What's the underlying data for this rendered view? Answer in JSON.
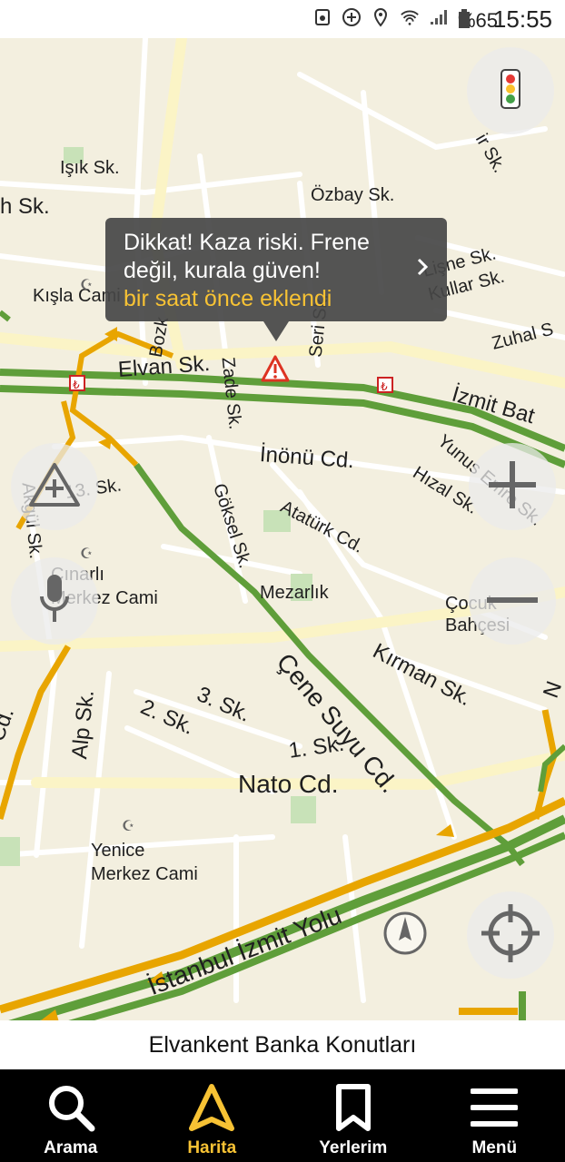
{
  "status_bar": {
    "icons": [
      "photo-icon",
      "add-circle-icon",
      "location-icon",
      "wifi-icon",
      "signal-icon"
    ],
    "battery": "%65",
    "time": "15:55"
  },
  "map": {
    "street_labels": {
      "isik": "Işık Sk.",
      "h": "h Sk.",
      "ozbay": "Özbay Sk.",
      "kisla": "Kışla Cami",
      "bozk": "Bozk",
      "zade": "Zade Sk.",
      "seri": "Seri Sk.",
      "lisne": "Lişne Sk.",
      "kullar": "Kullar Sk.",
      "zuhal": "Zuhal S",
      "ir": "ir Sk.",
      "elvan": "Elvan Sk.",
      "izmit_bat": "İzmit Bat",
      "akgul": "Akgül Sk.",
      "onuc": "13. Sk.",
      "inonu": "İnönü Cd.",
      "goksel": "Göksel Sk.",
      "ataturk": "Atatürk Cd.",
      "hizal": "Hızal Sk.",
      "yunus": "Yunus Emre Sk.",
      "cinarli": "Çınarlı",
      "merkez_cami": "Merkez Cami",
      "mezarlik": "Mezarlık",
      "cocuk": "Çocuk",
      "bahcesi": "Bahçesi",
      "kirman": "Kırman Sk.",
      "cene": "Çene Suyu Cd.",
      "cd_left": "Cd.",
      "alp": "Alp Sk.",
      "iki": "2. Sk.",
      "uc": "3. Sk.",
      "bir": "1. Sk.",
      "nato": "Nato Cd.",
      "yenice": "Yenice",
      "yenice_cami": "Merkez Cami",
      "istanbul_izmit": "İstanbul İzmit Yolu",
      "n_right": "N"
    },
    "alert": {
      "message": "Dikkat! Kaza riski. Frene değil, kurala güven!",
      "added": "bir saat önce eklendi"
    },
    "controls": [
      "traffic-light-icon",
      "add-road-event-icon",
      "zoom-in-icon",
      "voice-icon",
      "zoom-out-icon",
      "my-location-icon",
      "compass-icon"
    ],
    "colors": {
      "road_green": "#5f9e3a",
      "road_orange": "#e8a500",
      "map_bg": "#f3efdf",
      "accent": "#f7c234"
    }
  },
  "place_bar": {
    "text": "Elvankent Banka Konutları"
  },
  "bottom_nav": {
    "items": [
      {
        "label": "Arama",
        "icon": "search-icon"
      },
      {
        "label": "Harita",
        "icon": "navigation-arrow-icon",
        "active": true
      },
      {
        "label": "Yerlerim",
        "icon": "bookmark-icon"
      },
      {
        "label": "Menü",
        "icon": "menu-icon"
      }
    ]
  }
}
